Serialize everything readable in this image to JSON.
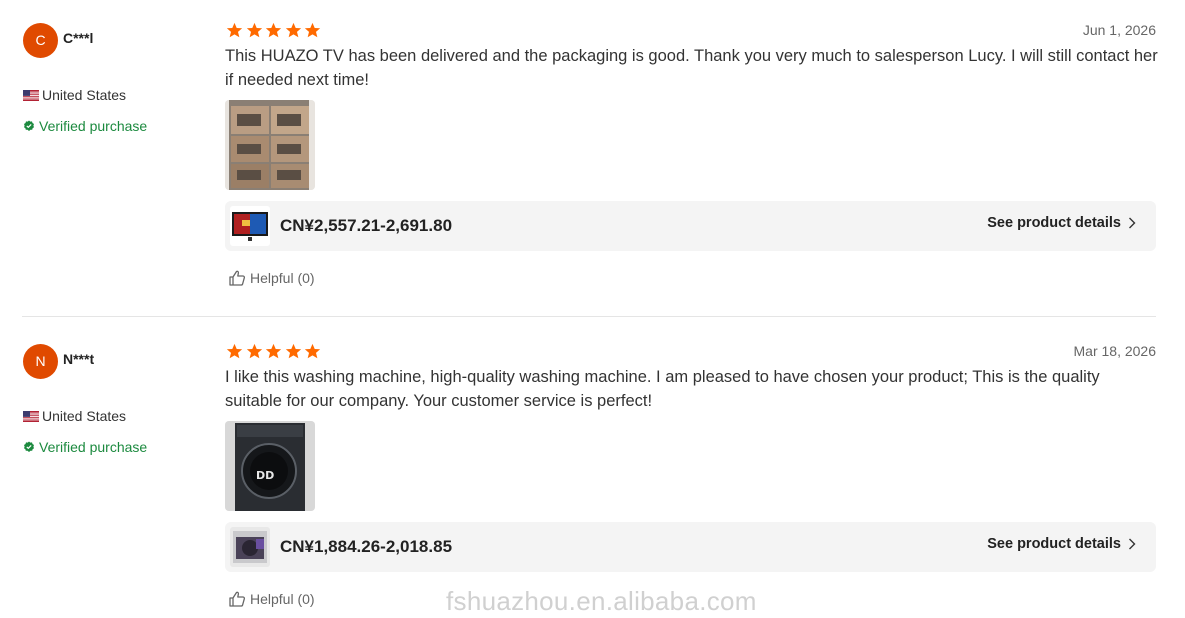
{
  "colors": {
    "accent": "#ff6a00",
    "avatar": "#e04a00",
    "verified": "#1c8a3f",
    "bar": "#f4f4f4"
  },
  "reviews": [
    {
      "avatar_letter": "C",
      "name": "C***l",
      "country": "United States",
      "verified": "Verified purchase",
      "rating": 5,
      "date": "Jun 1, 2026",
      "text": "This HUAZO TV has been delivered and the packaging is good. Thank you very much to salesperson Lucy. I will still contact her if needed next time!",
      "price": "CN¥2,557.21-2,691.80",
      "details_label": "See product details",
      "helpful": "Helpful (0)"
    },
    {
      "avatar_letter": "N",
      "name": "N***t",
      "country": "United States",
      "verified": "Verified purchase",
      "rating": 5,
      "date": "Mar 18, 2026",
      "text": "I like this washing machine, high-quality washing machine. I am pleased to have chosen your product; This is the quality suitable for our company. Your customer service is perfect!",
      "price": "CN¥1,884.26-2,018.85",
      "details_label": "See product details",
      "helpful": "Helpful (0)"
    }
  ],
  "watermark": "fshuazhou.en.alibaba.com"
}
